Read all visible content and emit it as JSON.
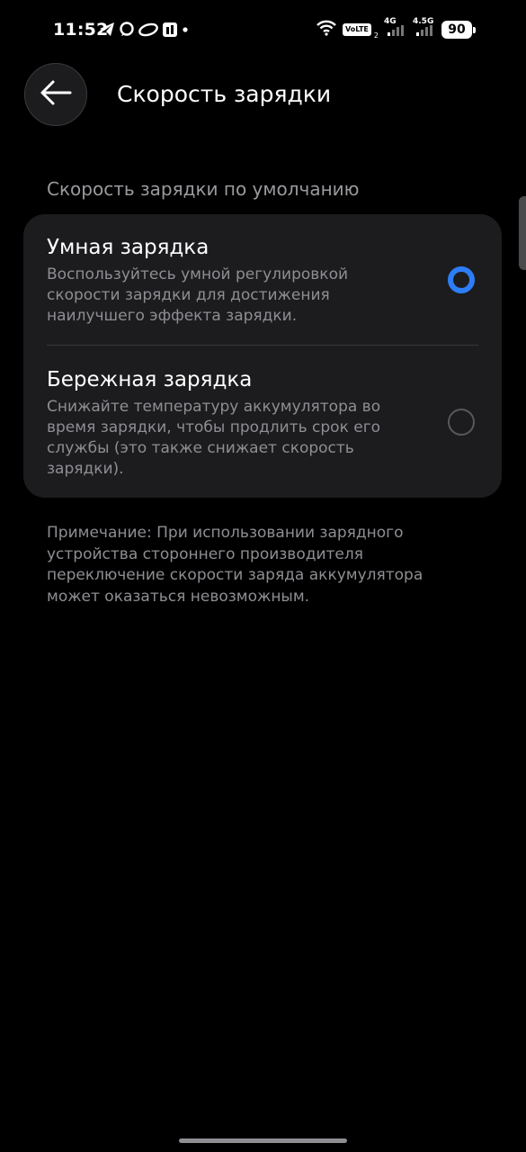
{
  "status_bar": {
    "time": "11:52",
    "volte": "VoLTE",
    "volte_sub": "2",
    "net1": "4G",
    "net2": "4.5G",
    "battery": "90",
    "notification_icons": [
      "telegram-icon",
      "chat-bubble-icon",
      "cloud-app-icon",
      "app-square-icon",
      "dot-icon"
    ]
  },
  "header": {
    "title": "Скорость зарядки"
  },
  "section": {
    "label": "Скорость зарядки по умолчанию"
  },
  "options": [
    {
      "title": "Умная зарядка",
      "description": "Воспользуйтесь умной регулировкой скорости зарядки для достижения наилучшего эффекта зарядки.",
      "selected": true
    },
    {
      "title": "Бережная зарядка",
      "description": "Снижайте температуру аккумулятора во время зарядки, чтобы продлить срок его службы (это также снижает скорость зарядки).",
      "selected": false
    }
  ],
  "note": "Примечание: При использовании зарядного устройства стороннего производителя переключение скорости заряда аккумулятора может оказаться невозможным.",
  "colors": {
    "accent": "#2d7df6",
    "card": "#1c1c1e",
    "background": "#000000",
    "secondary_text": "#8e8e93"
  }
}
